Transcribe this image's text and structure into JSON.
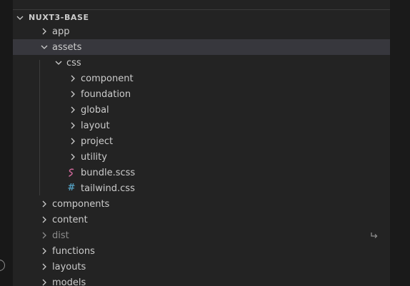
{
  "explorer": {
    "section_title": "NUXT3-BASE",
    "items": [
      {
        "label": "app"
      },
      {
        "label": "assets"
      },
      {
        "label": "css"
      },
      {
        "label": "component"
      },
      {
        "label": "foundation"
      },
      {
        "label": "global"
      },
      {
        "label": "layout"
      },
      {
        "label": "project"
      },
      {
        "label": "utility"
      },
      {
        "label": "bundle.scss",
        "icon": "sass-file-icon",
        "icon_color": "#cd6799"
      },
      {
        "label": "tailwind.css",
        "icon": "css-hash-icon",
        "icon_color": "#519aba",
        "icon_text": "#"
      },
      {
        "label": "components"
      },
      {
        "label": "content"
      },
      {
        "label": "dist",
        "status": "gitignored",
        "status_icon": "share-arrow-icon"
      },
      {
        "label": "functions"
      },
      {
        "label": "layouts"
      },
      {
        "label": "models"
      }
    ]
  },
  "colors": {
    "sidebar_bg": "#232323",
    "selected_row": "#37373d",
    "text": "#cccccc",
    "dim_text": "#8c8c8c"
  }
}
